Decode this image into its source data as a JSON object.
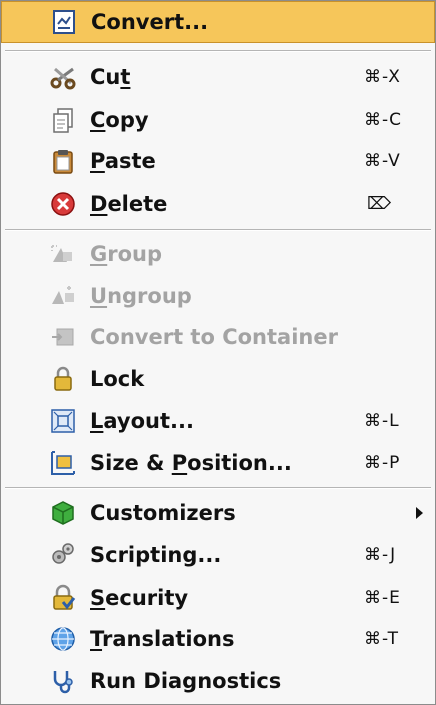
{
  "menu": {
    "items": [
      {
        "label": "Convert...",
        "mnemonic": "",
        "shortcut": "",
        "icon": "convert-icon",
        "state": "selected"
      },
      {
        "label": "Cut",
        "mnemonic": "t",
        "shortcut": "⌘-X",
        "icon": "scissors-icon",
        "state": "enabled"
      },
      {
        "label": "Copy",
        "mnemonic": "C",
        "shortcut": "⌘-C",
        "icon": "copy-document-icon",
        "state": "enabled"
      },
      {
        "label": "Paste",
        "mnemonic": "P",
        "shortcut": "⌘-V",
        "icon": "clipboard-icon",
        "state": "enabled"
      },
      {
        "label": "Delete",
        "mnemonic": "D",
        "shortcut": "⌦",
        "icon": "delete-icon",
        "state": "enabled"
      },
      {
        "label": "Group",
        "mnemonic": "G",
        "shortcut": "",
        "icon": "group-icon",
        "state": "disabled"
      },
      {
        "label": "Ungroup",
        "mnemonic": "U",
        "shortcut": "",
        "icon": "ungroup-icon",
        "state": "disabled"
      },
      {
        "label": "Convert to Container",
        "mnemonic": "",
        "shortcut": "",
        "icon": "container-icon",
        "state": "disabled"
      },
      {
        "label": "Lock",
        "mnemonic": "",
        "shortcut": "",
        "icon": "lock-icon",
        "state": "enabled"
      },
      {
        "label": "Layout...",
        "mnemonic": "L",
        "shortcut": "⌘-L",
        "icon": "layout-icon",
        "state": "enabled"
      },
      {
        "label": "Size & Position...",
        "mnemonic": "P",
        "shortcut": "⌘-P",
        "icon": "size-position-icon",
        "state": "enabled"
      },
      {
        "label": "Customizers",
        "mnemonic": "",
        "shortcut": "",
        "icon": "customizers-icon",
        "state": "submenu"
      },
      {
        "label": "Scripting...",
        "mnemonic": "",
        "shortcut": "⌘-J",
        "icon": "gears-icon",
        "state": "enabled"
      },
      {
        "label": "Security",
        "mnemonic": "S",
        "shortcut": "⌘-E",
        "icon": "security-icon",
        "state": "enabled"
      },
      {
        "label": "Translations",
        "mnemonic": "T",
        "shortcut": "⌘-T",
        "icon": "globe-icon",
        "state": "enabled"
      },
      {
        "label": "Run Diagnostics",
        "mnemonic": "",
        "shortcut": "",
        "icon": "stethoscope-icon",
        "state": "enabled"
      }
    ]
  },
  "colors": {
    "selection": "#f6c65a",
    "disabled_text": "#a3a3a3",
    "menu_background": "#f7f7f7"
  }
}
